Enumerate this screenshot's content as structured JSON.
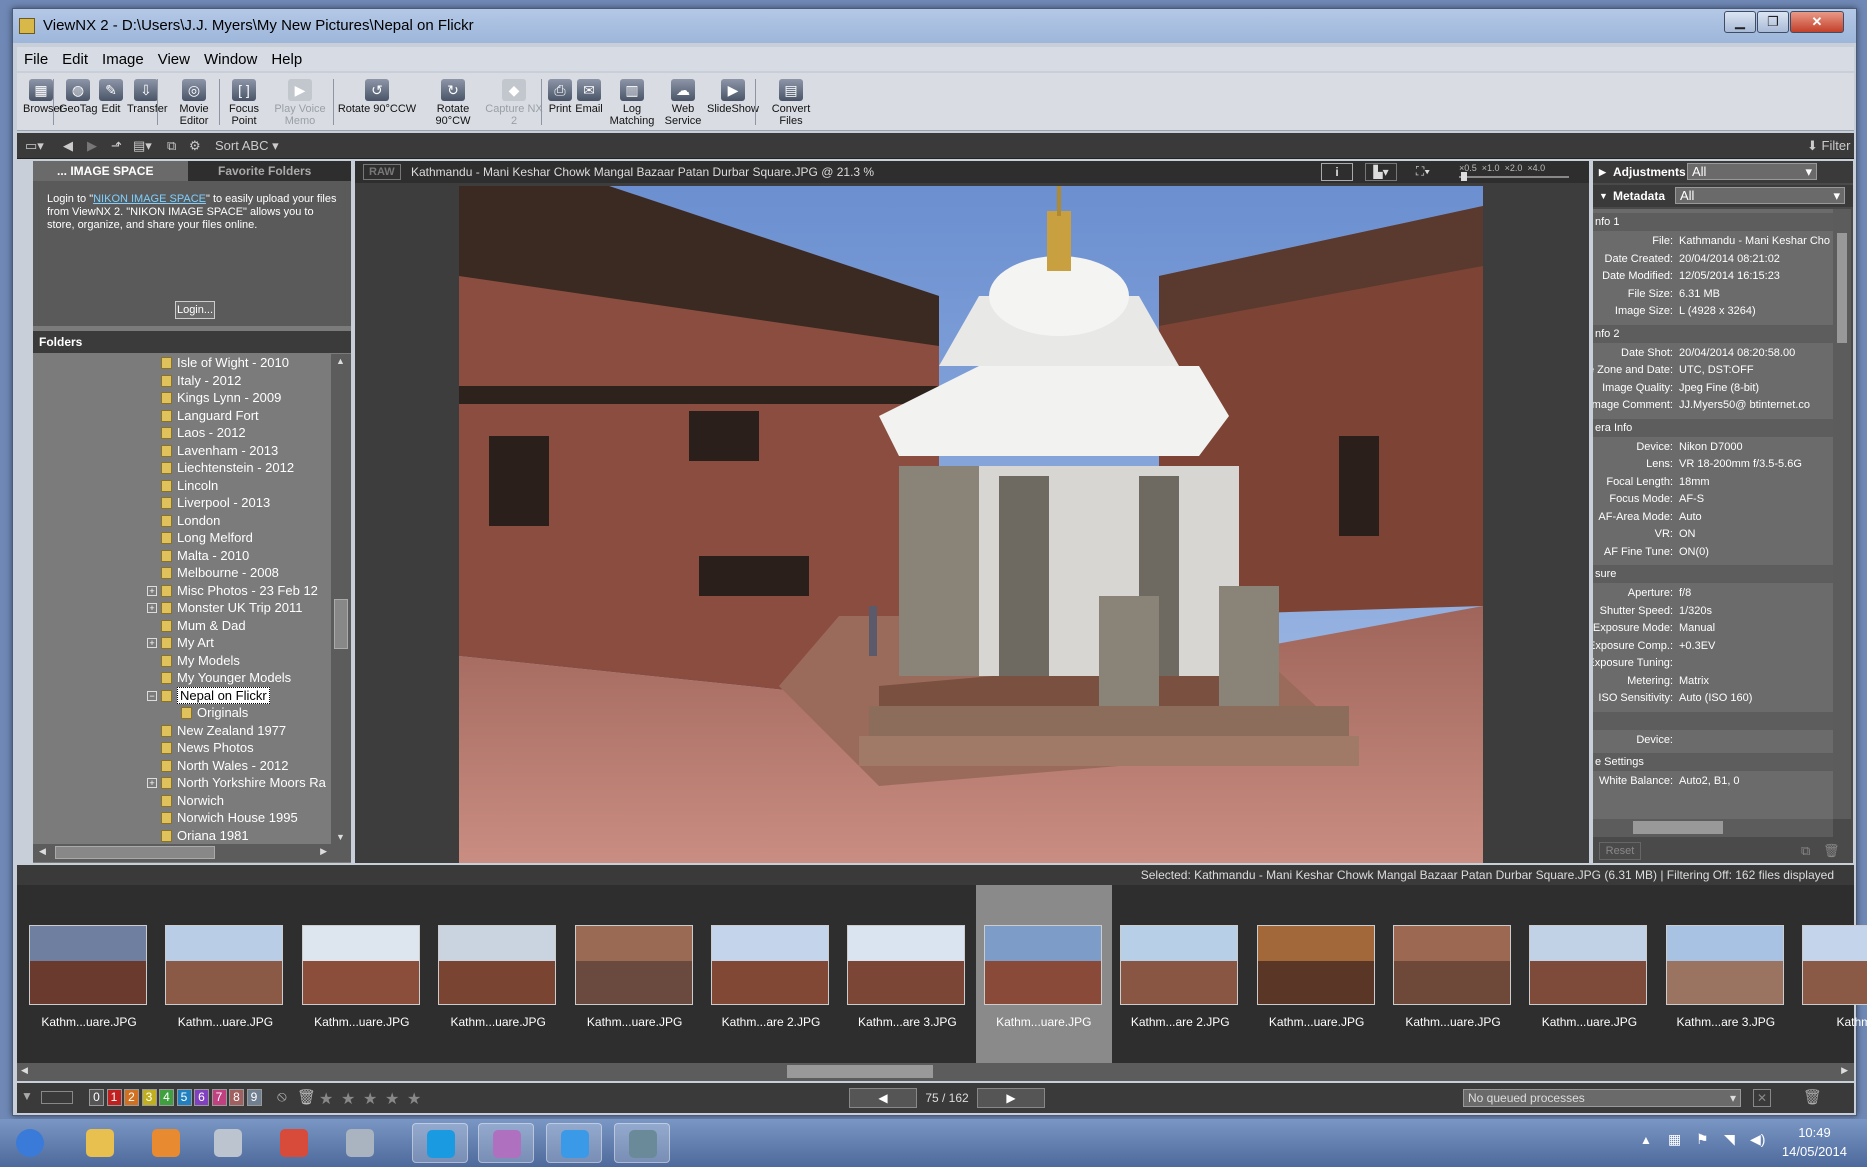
{
  "window": {
    "title": "ViewNX 2 - D:\\Users\\J.J. Myers\\My New Pictures\\Nepal on Flickr"
  },
  "menu": [
    "File",
    "Edit",
    "Image",
    "View",
    "Window",
    "Help"
  ],
  "toolbar": [
    {
      "label": "Browser",
      "icon": "browser-icon",
      "enabled": true
    },
    {
      "label": "GeoTag",
      "icon": "geotag-icon",
      "enabled": true
    },
    {
      "label": "Edit",
      "icon": "edit-icon",
      "enabled": true
    },
    {
      "label": "Transfer",
      "icon": "transfer-icon",
      "enabled": true
    },
    {
      "label": "Movie Editor",
      "icon": "movie-editor-icon",
      "enabled": true
    },
    {
      "label": "Focus Point",
      "icon": "focus-point-icon",
      "enabled": true
    },
    {
      "label": "Play Voice Memo",
      "icon": "voice-memo-icon",
      "enabled": false
    },
    {
      "label": "Rotate 90°CCW",
      "icon": "rotate-ccw-icon",
      "enabled": true
    },
    {
      "label": "Rotate 90°CW",
      "icon": "rotate-cw-icon",
      "enabled": true
    },
    {
      "label": "Capture NX 2",
      "icon": "capture-nx-icon",
      "enabled": false
    },
    {
      "label": "Print",
      "icon": "print-icon",
      "enabled": true
    },
    {
      "label": "Email",
      "icon": "email-icon",
      "enabled": true
    },
    {
      "label": "Log Matching",
      "icon": "log-matching-icon",
      "enabled": true
    },
    {
      "label": "Web Service",
      "icon": "web-service-icon",
      "enabled": true
    },
    {
      "label": "SlideShow",
      "icon": "slideshow-icon",
      "enabled": true
    },
    {
      "label": "Convert Files",
      "icon": "convert-files-icon",
      "enabled": true
    }
  ],
  "subbar": {
    "sort": "Sort ABC",
    "filter": "Filter"
  },
  "image_space": {
    "tab_active": "... IMAGE SPACE",
    "tab_other": "Favorite Folders",
    "text_before": "Login to \"",
    "link": "NIKON IMAGE SPACE",
    "text_after": "\" to easily upload your files from ViewNX 2. \"NIKON IMAGE SPACE\" allows you to store, organize, and share your files online.",
    "login": "Login..."
  },
  "folders": {
    "title": "Folders",
    "items": [
      {
        "name": "Isle of Wight - 2010",
        "expand": "",
        "level": 0
      },
      {
        "name": "Italy - 2012",
        "expand": "",
        "level": 0
      },
      {
        "name": "Kings Lynn - 2009",
        "expand": "",
        "level": 0
      },
      {
        "name": "Languard Fort",
        "expand": "",
        "level": 0
      },
      {
        "name": "Laos - 2012",
        "expand": "",
        "level": 0
      },
      {
        "name": "Lavenham - 2013",
        "expand": "",
        "level": 0
      },
      {
        "name": "Liechtenstein - 2012",
        "expand": "",
        "level": 0
      },
      {
        "name": "Lincoln",
        "expand": "",
        "level": 0
      },
      {
        "name": "Liverpool - 2013",
        "expand": "",
        "level": 0
      },
      {
        "name": "London",
        "expand": "",
        "level": 0
      },
      {
        "name": "Long Melford",
        "expand": "",
        "level": 0
      },
      {
        "name": "Malta - 2010",
        "expand": "",
        "level": 0
      },
      {
        "name": "Melbourne - 2008",
        "expand": "",
        "level": 0
      },
      {
        "name": "Misc Photos - 23 Feb 12",
        "expand": "+",
        "level": 0
      },
      {
        "name": "Monster UK Trip 2011",
        "expand": "+",
        "level": 0
      },
      {
        "name": "Mum & Dad",
        "expand": "",
        "level": 0
      },
      {
        "name": "My Art",
        "expand": "+",
        "level": 0
      },
      {
        "name": "My Models",
        "expand": "",
        "level": 0
      },
      {
        "name": "My Younger Models",
        "expand": "",
        "level": 0
      },
      {
        "name": "Nepal on Flickr",
        "expand": "−",
        "level": 0,
        "selected": true
      },
      {
        "name": "Originals",
        "expand": "",
        "level": 1
      },
      {
        "name": "New Zealand 1977",
        "expand": "",
        "level": 0
      },
      {
        "name": "News Photos",
        "expand": "",
        "level": 0
      },
      {
        "name": "North Wales - 2012",
        "expand": "",
        "level": 0
      },
      {
        "name": "North Yorkshire Moors Ra",
        "expand": "+",
        "level": 0
      },
      {
        "name": "Norwich",
        "expand": "",
        "level": 0
      },
      {
        "name": "Norwich House 1995",
        "expand": "",
        "level": 0
      },
      {
        "name": "Oriana 1981",
        "expand": "",
        "level": 0
      }
    ]
  },
  "viewer": {
    "raw_badge": "RAW",
    "caption": "Kathmandu - Mani Keshar Chowk Mangal Bazaar Patan Durbar Square.JPG @ 21.3 %",
    "zoom_levels": [
      "×0.5",
      "×1.0",
      "×2.0",
      "×4.0"
    ]
  },
  "right_panel": {
    "adjustments_label": "Adjustments",
    "adjustments_value": "All",
    "metadata_label": "Metadata",
    "metadata_value": "All",
    "groups": [
      {
        "title": "nfo 1",
        "rows": [
          [
            "File:",
            "Kathmandu - Mani Keshar Cho"
          ],
          [
            "Date Created:",
            "20/04/2014 08:21:02"
          ],
          [
            "Date Modified:",
            "12/05/2014 16:15:23"
          ],
          [
            "File Size:",
            "6.31 MB"
          ],
          [
            "Image Size:",
            "L (4928 x 3264)"
          ]
        ]
      },
      {
        "title": "nfo 2",
        "rows": [
          [
            "Date Shot:",
            "20/04/2014 08:20:58.00"
          ],
          [
            "me Zone and Date:",
            "UTC, DST:OFF"
          ],
          [
            "Image Quality:",
            "Jpeg Fine (8-bit)"
          ],
          [
            "Image Comment:",
            "JJ.Myers50@      btinternet.co"
          ]
        ]
      },
      {
        "title": "era Info",
        "rows": [
          [
            "Device:",
            "Nikon D7000"
          ],
          [
            "Lens:",
            "VR 18-200mm f/3.5-5.6G"
          ],
          [
            "Focal Length:",
            "18mm"
          ],
          [
            "Focus Mode:",
            "AF-S"
          ],
          [
            "AF-Area Mode:",
            "Auto"
          ],
          [
            "VR:",
            "ON"
          ],
          [
            "AF Fine Tune:",
            "ON(0)"
          ]
        ]
      },
      {
        "title": "sure",
        "rows": [
          [
            "Aperture:",
            "f/8"
          ],
          [
            "Shutter Speed:",
            "1/320s"
          ],
          [
            "Exposure Mode:",
            "Manual"
          ],
          [
            "Exposure Comp.:",
            "+0.3EV"
          ],
          [
            "Exposure Tuning:",
            ""
          ],
          [
            "Metering:",
            "Matrix"
          ],
          [
            "ISO Sensitivity:",
            "Auto (ISO 160)"
          ]
        ]
      },
      {
        "title": "",
        "rows": [
          [
            "Device:",
            ""
          ]
        ]
      },
      {
        "title": "e Settings",
        "rows": [
          [
            "White Balance:",
            "Auto2, B1, 0"
          ]
        ]
      }
    ],
    "reset": "Reset"
  },
  "status": "Selected: Kathmandu - Mani Keshar Chowk Mangal Bazaar Patan Durbar Square.JPG (6.31 MB) | Filtering Off: 162 files displayed",
  "thumbnails": [
    {
      "caption": "Kathm...uare.JPG",
      "sky": "#6e7fa0",
      "ground": "#6a3a2e",
      "selected": false
    },
    {
      "caption": "Kathm...uare.JPG",
      "sky": "#b9cde6",
      "ground": "#8a5a46",
      "selected": false
    },
    {
      "caption": "Kathm...uare.JPG",
      "sky": "#dde6ef",
      "ground": "#8a4e3a",
      "selected": false
    },
    {
      "caption": "Kathm...uare.JPG",
      "sky": "#c9d4e0",
      "ground": "#7a4432",
      "selected": false
    },
    {
      "caption": "Kathm...uare.JPG",
      "sky": "#9a6a54",
      "ground": "#6a4a3e",
      "selected": false
    },
    {
      "caption": "Kathm...are 2.JPG",
      "sky": "#c4d4ea",
      "ground": "#824836",
      "selected": false
    },
    {
      "caption": "Kathm...are 3.JPG",
      "sky": "#d9e4f0",
      "ground": "#7c4636",
      "selected": false
    },
    {
      "caption": "Kathm...uare.JPG",
      "sky": "#7e9cc8",
      "ground": "#8a4a3a",
      "selected": true
    },
    {
      "caption": "Kathm...are 2.JPG",
      "sky": "#b8cfe8",
      "ground": "#8a5644",
      "selected": false
    },
    {
      "caption": "Kathm...uare.JPG",
      "sky": "#a3683a",
      "ground": "#5a3626",
      "selected": false
    },
    {
      "caption": "Kathm...uare.JPG",
      "sky": "#9c6852",
      "ground": "#6e4838",
      "selected": false
    },
    {
      "caption": "Kathm...uare.JPG",
      "sky": "#c2d2e6",
      "ground": "#7e4a3a",
      "selected": false
    },
    {
      "caption": "Kathm...are 3.JPG",
      "sky": "#a8c2e4",
      "ground": "#9a7460",
      "selected": false
    },
    {
      "caption": "Kathm...a",
      "sky": "#c4d4ea",
      "ground": "#8a5a46",
      "selected": false
    }
  ],
  "bottom": {
    "labels": [
      "0",
      "1",
      "2",
      "3",
      "4",
      "5",
      "6",
      "7",
      "8",
      "9"
    ],
    "label_colors": [
      "#555",
      "#c02020",
      "#d07020",
      "#c0b020",
      "#40a040",
      "#2080c0",
      "#8040c0",
      "#c04080",
      "#a06060",
      "#708090"
    ],
    "page": "75 / 162",
    "queue": "No queued processes"
  },
  "taskbar": {
    "time": "10:49",
    "date": "14/05/2014",
    "apps": [
      "start-icon",
      "explorer-icon",
      "media-player-icon",
      "app-icon",
      "chrome-icon",
      "app-grid-icon",
      "skype-icon",
      "paint-icon",
      "ie-icon",
      "viewnx-icon"
    ]
  }
}
